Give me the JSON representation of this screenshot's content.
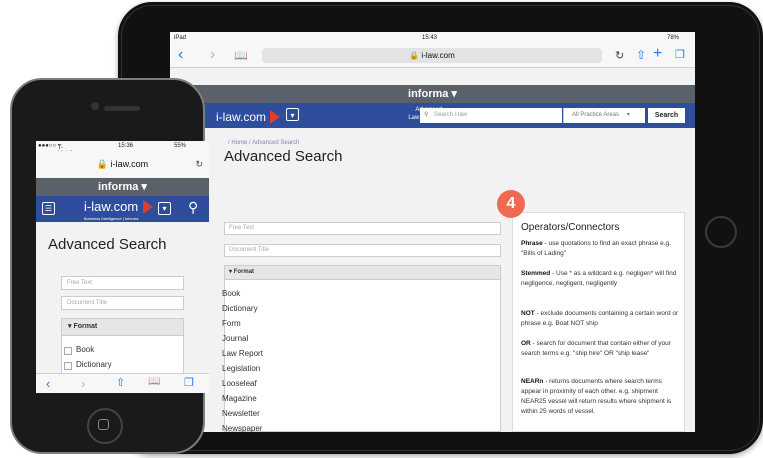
{
  "ipad": {
    "status": {
      "device": "iPad",
      "time": "15:43",
      "battery": "78%"
    },
    "url": "i-law.com",
    "brand_bar": "informa",
    "logo": "i-law.com",
    "advanced_link": [
      "Advanced",
      "Law Reports"
    ],
    "search_placeholder": "Search i-law",
    "practice_area": "All Practice Areas",
    "search_button": "Search",
    "breadcrumb": "/ Home / Advanced Search",
    "page_title": "Advanced Search",
    "fields": {
      "free_text": "Free Text",
      "document_title": "Document Title"
    },
    "format_header": "Format",
    "format_items": [
      "Book",
      "Dictionary",
      "Form",
      "Journal",
      "Law Report",
      "Legislation",
      "Looseleaf",
      "Magazine",
      "Newsletter",
      "Newspaper"
    ],
    "badge": "4",
    "operators": {
      "title": "Operators/Connectors",
      "items": [
        {
          "term": "Phrase",
          "text": " - use quotations to find an exact phrase e.g. \"Bills of Lading\""
        },
        {
          "term": "Stemmed",
          "text": " - Use * as a wildcard e.g. negligen* will find negligence, negligent, negligently"
        },
        {
          "term": "NOT",
          "text": " - exclude documents containing a certain word or phrase e.g. Boat NOT ship"
        },
        {
          "term": "OR",
          "text": " - search for document that contain either of your search terms e.g. \"ship hire\" OR \"ship lease\""
        },
        {
          "term": "NEARn",
          "text": " - returns documents where search terms appear in proximity of each other. e.g. shipment NEAR25 vessel will return results where shipment is within 25 words of vessel."
        }
      ]
    }
  },
  "iphone": {
    "status": {
      "carrier": "T-Mobile",
      "time": "15:36",
      "battery": "55%"
    },
    "url": "i-law.com",
    "brand_bar": "informa",
    "logo": "i-law.com",
    "logo_tagline": "Business Intelligence | Informa",
    "page_title": "Advanced Search",
    "fields": {
      "free_text": "Free Text",
      "document_title": "Document Title"
    },
    "format_header": "Format",
    "format_items": [
      "Book",
      "Dictionary"
    ]
  },
  "colors": {
    "nav_blue": "#2e4d9c",
    "informa_gray": "#5a6169",
    "badge": "#ef6a50",
    "ios_blue": "#1a7cf5"
  }
}
